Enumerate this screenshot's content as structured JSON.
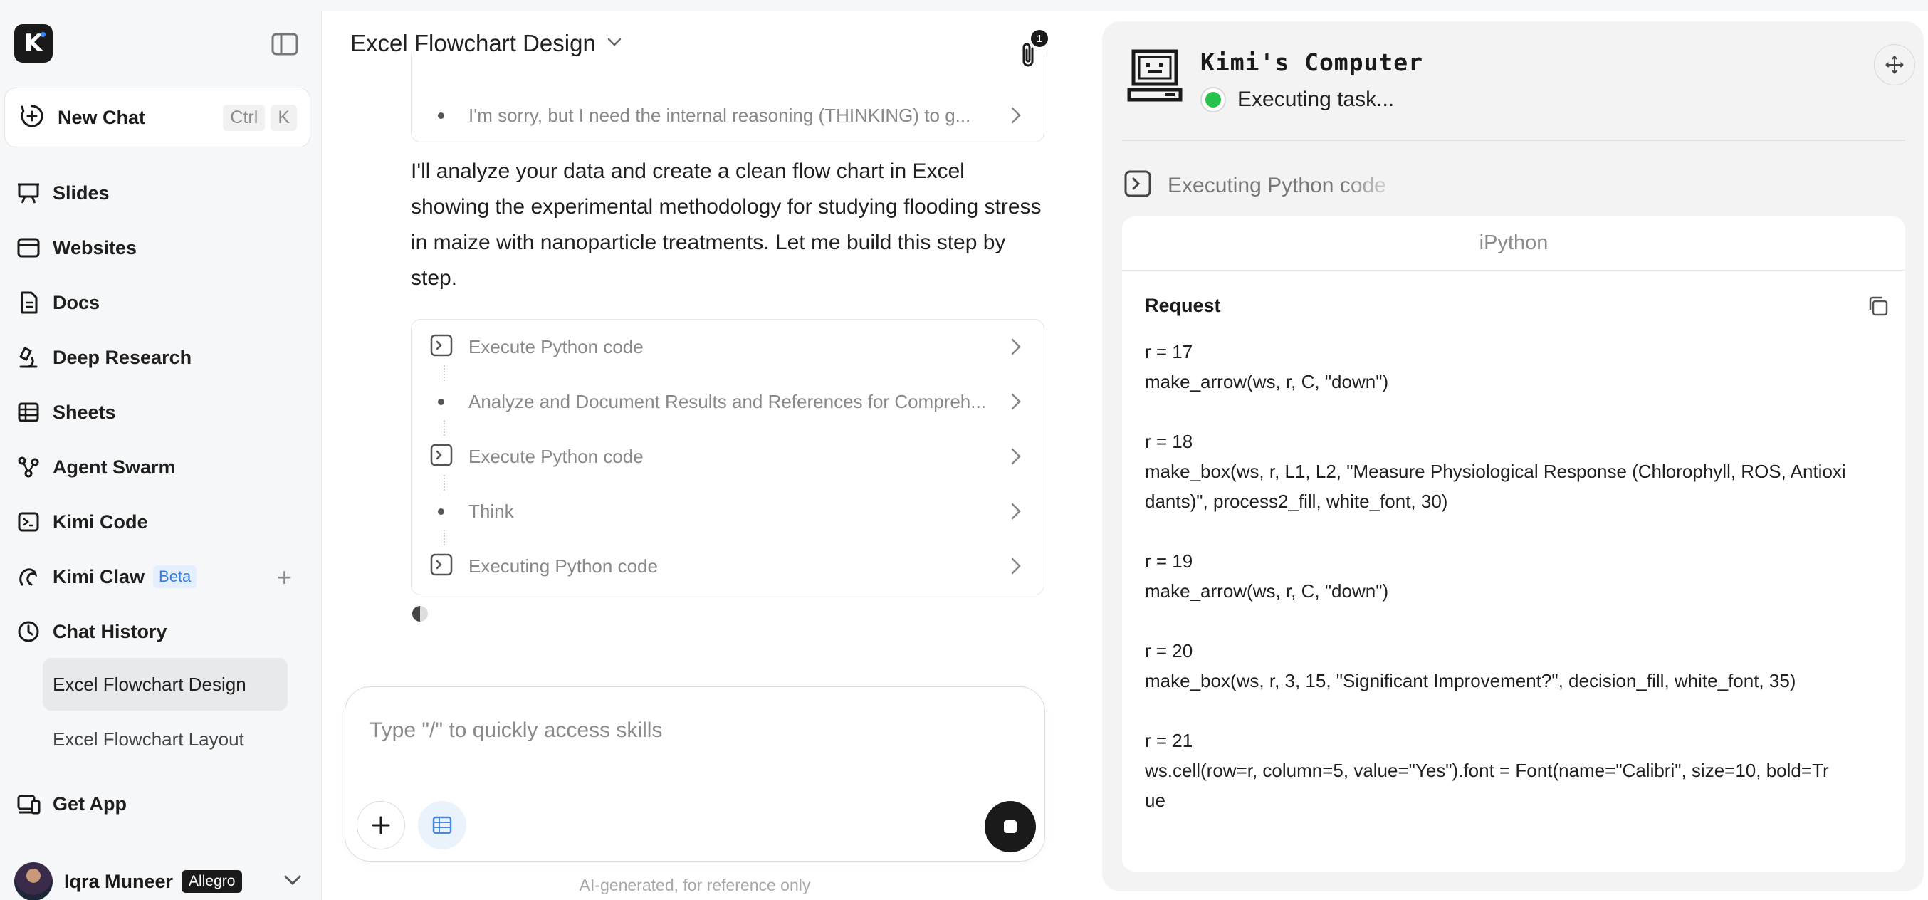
{
  "sidebar": {
    "new_chat_label": "New Chat",
    "shortcut": [
      "Ctrl",
      "K"
    ],
    "nav": [
      {
        "label": "Slides",
        "icon": "presentation-icon"
      },
      {
        "label": "Websites",
        "icon": "browser-window-icon"
      },
      {
        "label": "Docs",
        "icon": "document-icon"
      },
      {
        "label": "Deep Research",
        "icon": "microscope-icon"
      },
      {
        "label": "Sheets",
        "icon": "table-icon"
      },
      {
        "label": "Agent Swarm",
        "icon": "agent-swarm-icon"
      },
      {
        "label": "Kimi Code",
        "icon": "terminal-icon"
      },
      {
        "label": "Kimi Claw",
        "icon": "claw-icon",
        "badge": "Beta"
      },
      {
        "label": "Chat History",
        "icon": "clock-icon"
      }
    ],
    "history": [
      {
        "label": "Excel Flowchart Design",
        "active": true
      },
      {
        "label": "Excel Flowchart Layout",
        "active": false
      }
    ],
    "get_app_label": "Get App",
    "user": {
      "name": "Iqra Muneer",
      "tier": "Allegro"
    }
  },
  "chat": {
    "title": "Excel Flowchart Design",
    "attachment_count": "1",
    "top_step": "I'm sorry, but I need the internal reasoning (THINKING) to g...",
    "message": "I'll analyze your data and create a clean flow chart in Excel showing the experimental methodology for studying flooding stress in maize with nanoparticle treatments. Let me build this step by step.",
    "steps": [
      {
        "label": "Execute Python code",
        "kind": "code"
      },
      {
        "label": "Analyze and Document Results and References for Compreh...",
        "kind": "bullet"
      },
      {
        "label": "Execute Python code",
        "kind": "code"
      },
      {
        "label": "Think",
        "kind": "bullet"
      },
      {
        "label": "Executing Python code",
        "kind": "code"
      }
    ],
    "input_placeholder": "Type \"/\" to quickly access skills",
    "disclaimer": "AI-generated, for reference only"
  },
  "computer": {
    "title": "Kimi's Computer",
    "status": "Executing task...",
    "current_action": "Executing Python code",
    "tool_name": "iPython",
    "request_label": "Request",
    "code_lines": [
      "r = 17",
      "make_arrow(ws, r, C, \"down\")",
      "",
      "r = 18",
      "make_box(ws, r, L1, L2, \"Measure Physiological Response (Chlorophyll, ROS, Antioxi",
      "dants)\", process2_fill, white_font, 30)",
      "",
      "r = 19",
      "make_arrow(ws, r, C, \"down\")",
      "",
      "r = 20",
      "make_box(ws, r, 3, 15, \"Significant Improvement?\", decision_fill, white_font, 35)",
      "",
      "r = 21",
      "ws.cell(row=r, column=5, value=\"Yes\").font = Font(name=\"Calibri\", size=10, bold=Tr",
      "ue"
    ]
  }
}
